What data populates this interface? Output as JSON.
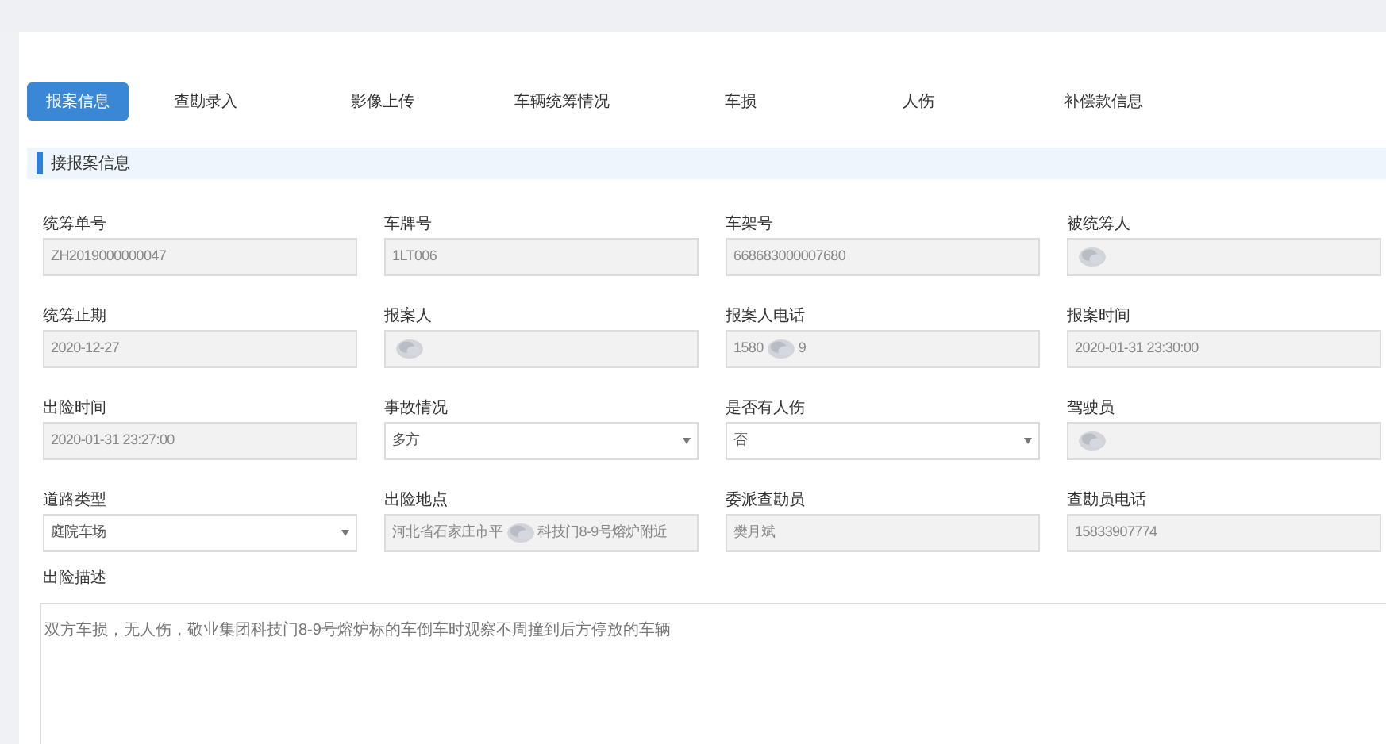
{
  "tabs": [
    {
      "label": "报案信息",
      "selected": true
    },
    {
      "label": "查勘录入",
      "selected": false
    },
    {
      "label": "影像上传",
      "selected": false
    },
    {
      "label": "车辆统筹情况",
      "selected": false
    },
    {
      "label": "车损",
      "selected": false
    },
    {
      "label": "人伤",
      "selected": false
    },
    {
      "label": "补偿款信息",
      "selected": false
    }
  ],
  "section": {
    "title": "接报案信息"
  },
  "fields": [
    {
      "label": "统筹单号",
      "kind": "readonly",
      "value_parts": [
        "ZH2019000000047"
      ],
      "redacted": false
    },
    {
      "label": "车牌号",
      "kind": "readonly",
      "value_parts": [
        "1LT006"
      ],
      "redacted": false
    },
    {
      "label": "车架号",
      "kind": "readonly",
      "value_parts": [
        "668683000007680"
      ],
      "redacted": false
    },
    {
      "label": "被统筹人",
      "kind": "readonly",
      "redacted": true
    },
    {
      "label": "统筹止期",
      "kind": "readonly",
      "value_parts": [
        "2020-12-27"
      ],
      "redacted": false
    },
    {
      "label": "报案人",
      "kind": "readonly",
      "redacted": true
    },
    {
      "label": "报案人电话",
      "kind": "readonly",
      "value_parts": [
        "1580",
        "9"
      ],
      "redacted": true
    },
    {
      "label": "报案时间",
      "kind": "readonly",
      "value_parts": [
        "2020-01-31 23:30:00"
      ],
      "redacted": false
    },
    {
      "label": "出险时间",
      "kind": "readonly",
      "value_parts": [
        "2020-01-31 23:27:00"
      ],
      "redacted": false
    },
    {
      "label": "事故情况",
      "kind": "select",
      "value_parts": [
        "多方"
      ],
      "redacted": false
    },
    {
      "label": "是否有人伤",
      "kind": "select",
      "value_parts": [
        "否"
      ],
      "redacted": false
    },
    {
      "label": "驾驶员",
      "kind": "readonly",
      "redacted": true
    },
    {
      "label": "道路类型",
      "kind": "select",
      "value_parts": [
        "庭院车场"
      ],
      "redacted": false
    },
    {
      "label": "出险地点",
      "kind": "readonly",
      "value_parts": [
        "河北省石家庄市平",
        "科技门8-9号熔炉附近"
      ],
      "redacted": true
    },
    {
      "label": "委派查勘员",
      "kind": "readonly",
      "value_parts": [
        "樊月斌"
      ],
      "redacted": false
    },
    {
      "label": "查勘员电话",
      "kind": "readonly",
      "value_parts": [
        "15833907774"
      ],
      "redacted": false
    }
  ],
  "description": {
    "label": "出险描述",
    "value": "双方车损，无人伤，敬业集团科技门8-9号熔炉标的车倒车时观察不周撞到后方停放的车辆"
  }
}
